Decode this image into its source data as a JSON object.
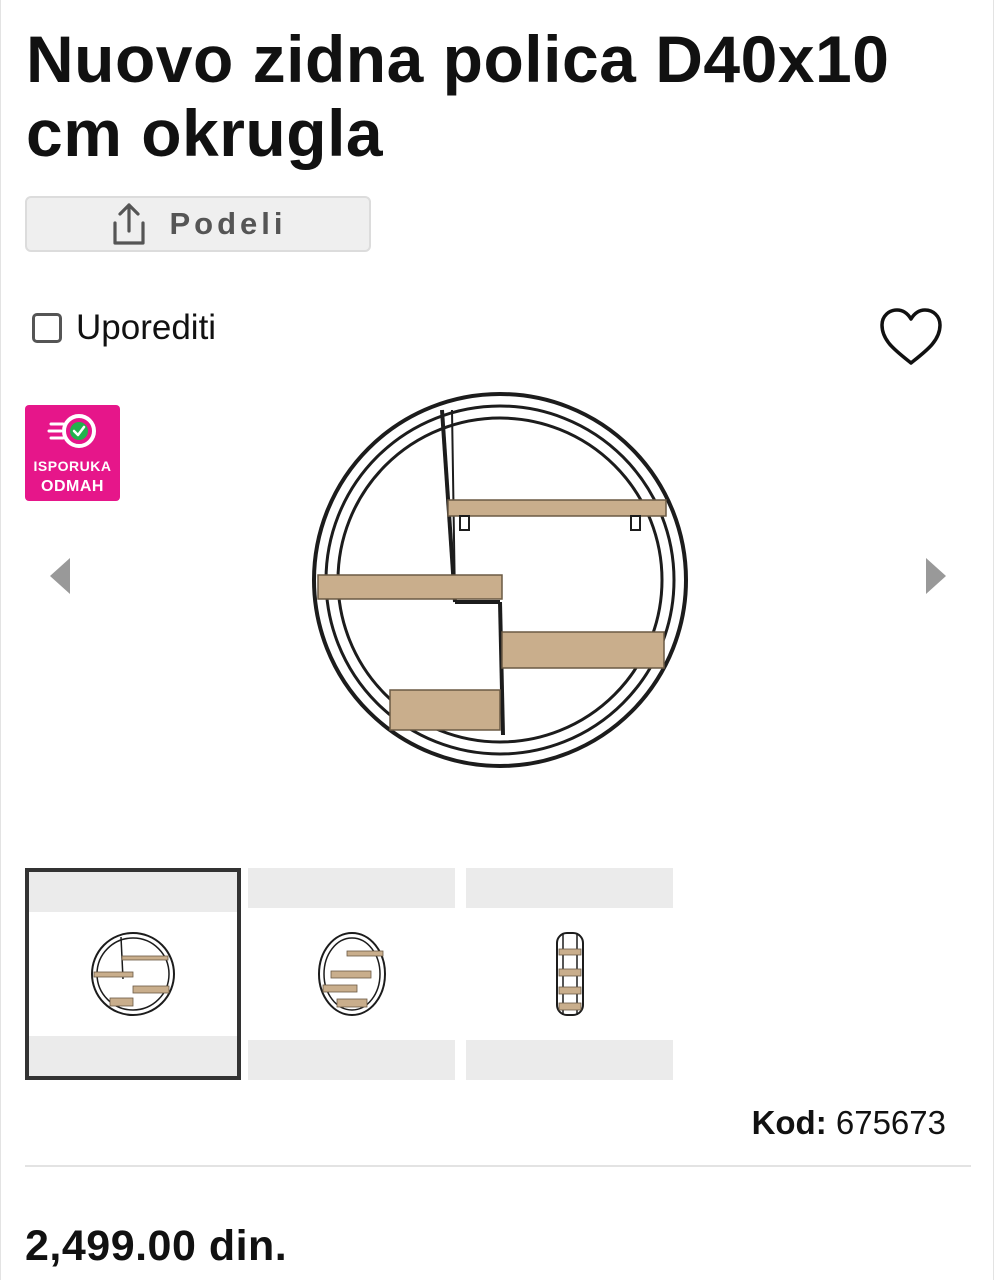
{
  "product": {
    "title": "Nuovo zidna polica D40x10 cm okrugla",
    "code_label": "Kod:",
    "code_value": "675673",
    "price": "2,499.00 din."
  },
  "actions": {
    "share_label": "Podeli",
    "compare_label": "Uporediti",
    "compare_checked": false,
    "favorite_icon": "heart-icon"
  },
  "badge": {
    "line1": "ISPORUKA",
    "line2": "ODMAH",
    "color": "#e6168a",
    "icon": "fast-delivery-icon"
  },
  "gallery": {
    "selected_index": 0,
    "thumbnails": [
      "front-view",
      "angled-view",
      "side-view"
    ],
    "prev_icon": "chevron-left-icon",
    "next_icon": "chevron-right-icon"
  }
}
